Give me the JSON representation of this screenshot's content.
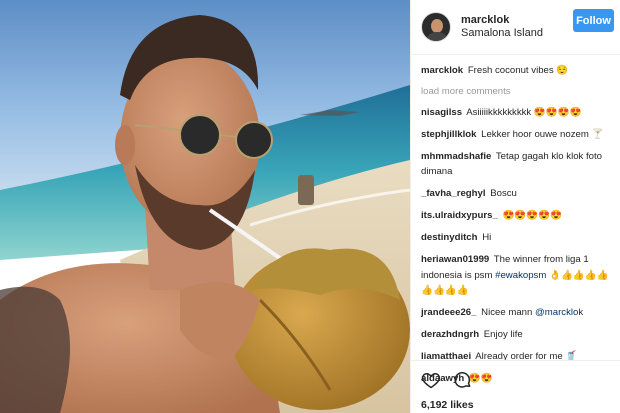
{
  "post": {
    "username": "marcklok",
    "location": "Samalona Island",
    "follow_label": "Follow",
    "caption_user": "marcklok",
    "caption_text": "Fresh coconut vibes 😌",
    "load_more": "load more comments",
    "likes": "6,192 likes"
  },
  "comments": [
    {
      "user": "nisagilss",
      "text": "Asiiiiikkkkkkkkk 😍😍😍😍"
    },
    {
      "user": "stephjillklok",
      "text": "Lekker hoor ouwe nozem 🍸"
    },
    {
      "user": "mhmmadshafie",
      "text": "Tetap gagah klo klok foto dimana"
    },
    {
      "user": "_favha_reghyl",
      "text": "Boscu"
    },
    {
      "user": "its.ulraidxypurs_",
      "text": "😍😍😍😍😍"
    },
    {
      "user": "destinyditch",
      "text": "Hi"
    },
    {
      "user": "heriawan01999",
      "text": "The winner from liga 1 indonesia is psm",
      "tag": "#ewakopsm",
      "tail": "👌👍👍👍👍👍👍👍👍"
    },
    {
      "user": "jrandeee26_",
      "text": "Nicee mann",
      "mention": "@marcklok"
    },
    {
      "user": "derazhdngrh",
      "text": "Enjoy life"
    },
    {
      "user": "liamatthaei",
      "text": "Already order for me 🥤"
    },
    {
      "user": "aldaawyh",
      "text": "😍😍"
    }
  ],
  "icons": {
    "like": "heart-icon",
    "comment": "comment-icon"
  }
}
